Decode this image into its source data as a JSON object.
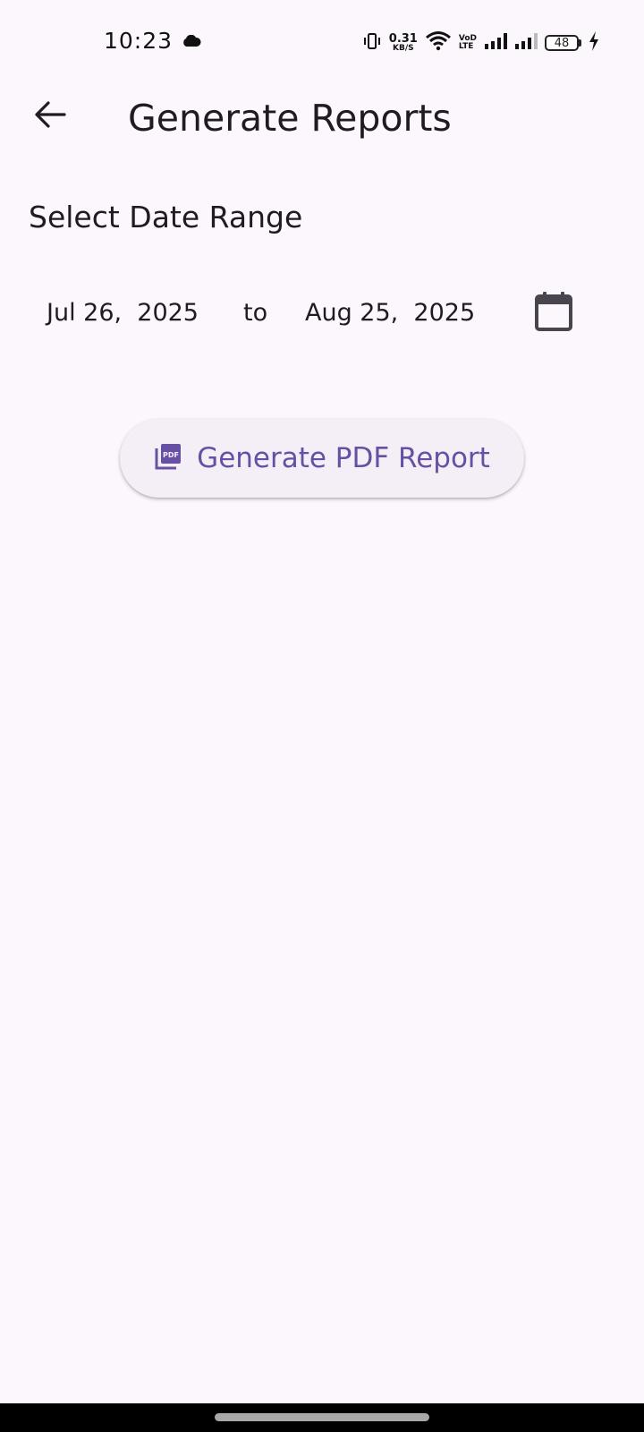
{
  "status_bar": {
    "time": "10:23",
    "net_speed_value": "0.31",
    "net_speed_unit": "KB/S",
    "volte_top": "VoD",
    "volte_bottom": "LTE",
    "battery_level": "48",
    "icons": [
      "cloud-icon",
      "vibrate-icon",
      "wifi-icon",
      "signal-icon",
      "signal-icon",
      "battery-icon",
      "charging-icon"
    ]
  },
  "app_bar": {
    "back_icon": "arrow-back-icon",
    "title": "Generate Reports"
  },
  "date_range": {
    "label": "Select Date Range",
    "start": "Jul 26,  2025",
    "separator": "to",
    "end": "Aug 25,  2025",
    "calendar_icon": "calendar-icon"
  },
  "generate_button": {
    "label": "Generate PDF Report",
    "icon": "pdf-icon"
  },
  "colors": {
    "background": "#fcf7fc",
    "text": "#1f1b20",
    "accent": "#6750a4",
    "button_bg": "#f4eff6"
  }
}
